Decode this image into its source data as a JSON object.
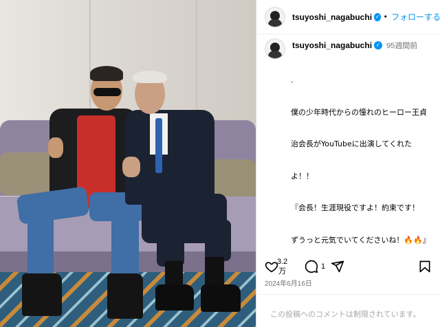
{
  "post": {
    "username": "tsuyoshi_nagabuchi",
    "verified": true,
    "follow_label": "フォローする",
    "follow_separator": "•",
    "time_ago": "95週間前",
    "caption_lines": [
      ".",
      "僕の少年時代からの憧れのヒーロー王貞",
      "治会長がYouTubeに出演してくれた",
      "よ！！",
      "『会長！生涯現役ですよ！約束です！",
      "ずうっと元気でいてくださいね！🔥🔥』"
    ],
    "likes": {
      "line1": "3.2",
      "line2": "万"
    },
    "comments": "1",
    "date": "2024年6月16日",
    "comments_notice": "この投稿へのコメントは制限されています。"
  },
  "icons": {
    "verified": "verified-badge-icon",
    "like": "heart-icon",
    "comment": "comment-bubble-icon",
    "share": "paper-plane-icon",
    "save": "bookmark-icon"
  },
  "colors": {
    "accent": "#0095f6",
    "muted": "#737373",
    "notice": "#a8a8a8"
  }
}
